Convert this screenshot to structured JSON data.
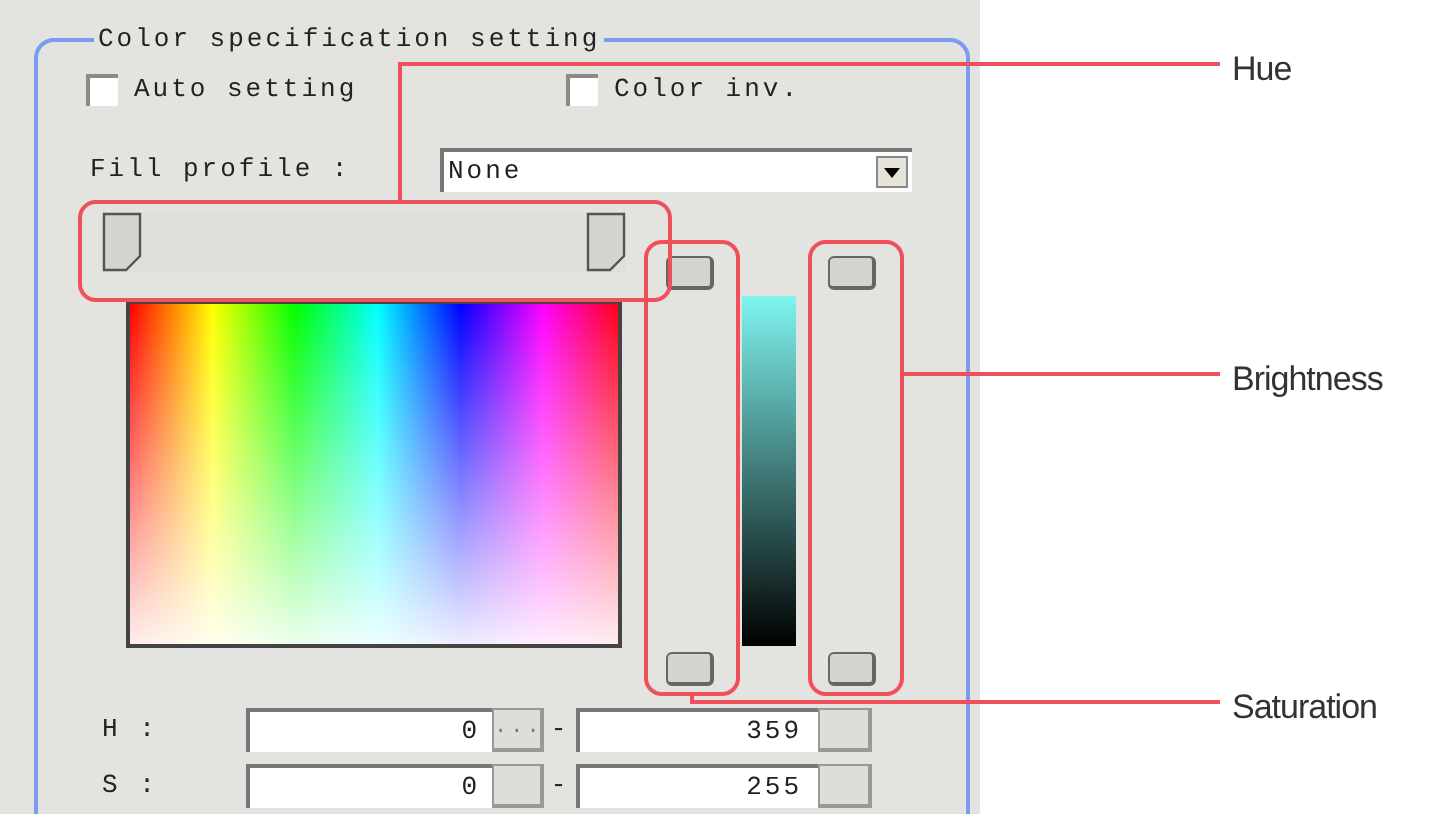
{
  "group": {
    "title": "Color specification setting"
  },
  "checkboxes": [
    {
      "label": "Auto setting",
      "checked": false
    },
    {
      "label": "Color inv.",
      "checked": false
    }
  ],
  "fill_profile": {
    "label": "Fill profile :",
    "value": "None"
  },
  "hue_slider": {
    "thumbs": [
      {
        "level": 0
      },
      {
        "level": 1
      }
    ]
  },
  "saturation_slider": {
    "thumbs": [
      {
        "level": 1
      },
      {
        "level": 0
      }
    ]
  },
  "brightness_slider": {
    "thumbs": [
      {
        "level": 1
      },
      {
        "level": 0
      }
    ]
  },
  "ranges": [
    {
      "label": "H :",
      "min": "0",
      "min_button": "...",
      "separator": "-",
      "max": "359"
    },
    {
      "label": "S :",
      "min": "0",
      "separator": "-",
      "max": "255"
    }
  ],
  "callouts": [
    {
      "label": "Hue"
    },
    {
      "label": "Brightness"
    },
    {
      "label": "Saturation"
    }
  ]
}
